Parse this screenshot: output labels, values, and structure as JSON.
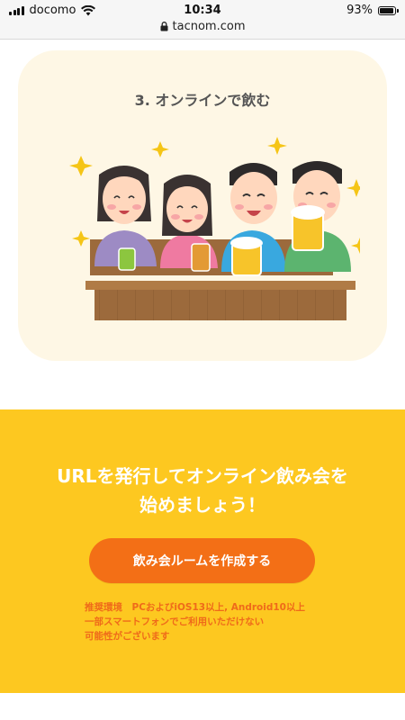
{
  "status_bar": {
    "carrier": "docomo",
    "time": "10:34",
    "battery_percent": "93%",
    "battery_level": 0.93,
    "url": "tacnom.com"
  },
  "card": {
    "title": "3. オンラインで飲む",
    "image_icon": "drinking-party-illustration"
  },
  "cta": {
    "heading_line1": "URLを発行してオンライン飲み会を",
    "heading_line2": "始めましょう！",
    "button_label": "飲み会ルームを作成する",
    "note_line1": "推奨環境　PCおよびiOS13以上, Android10以上",
    "note_line2": "一部スマートフォンでご利用いただけない",
    "note_line3": "可能性がございます"
  },
  "colors": {
    "card_bg": "#fef7e5",
    "cta_bg": "#fdc820",
    "button_bg": "#f36f16",
    "note_text": "#ef6a1a"
  }
}
